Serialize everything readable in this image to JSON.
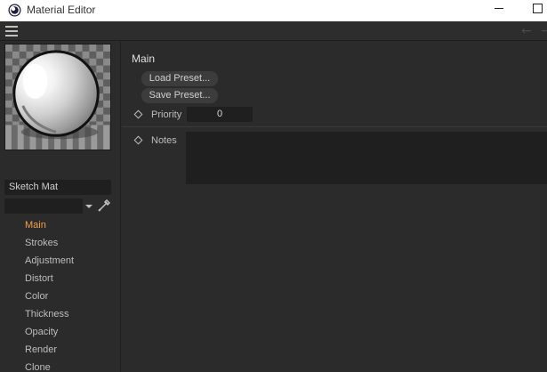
{
  "window": {
    "title": "Material Editor",
    "app_icon": "cinema4d-logo-icon"
  },
  "toolbar": {
    "menu_icon": "hamburger-menu-icon",
    "back_icon": "arrow-left-icon",
    "forward_icon": "arrow-right-icon"
  },
  "material": {
    "name": "Sketch Mat",
    "preview_icon": "material-sphere-preview",
    "picker_icon": "eyedropper-icon"
  },
  "channels": [
    {
      "label": "Main",
      "active": true
    },
    {
      "label": "Strokes",
      "active": false
    },
    {
      "label": "Adjustment",
      "active": false
    },
    {
      "label": "Distort",
      "active": false
    },
    {
      "label": "Color",
      "active": false
    },
    {
      "label": "Thickness",
      "active": false
    },
    {
      "label": "Opacity",
      "active": false
    },
    {
      "label": "Render",
      "active": false
    },
    {
      "label": "Clone",
      "active": false
    }
  ],
  "main_panel": {
    "title": "Main",
    "load_preset_label": "Load Preset...",
    "save_preset_label": "Save Preset...",
    "priority_label": "Priority",
    "priority_value": "0",
    "notes_label": "Notes",
    "notes_value": ""
  },
  "colors": {
    "active_channel": "#f3a04a",
    "background": "#2b2b2b",
    "field": "#1f1f1f",
    "titlebar": "#ffffff"
  }
}
